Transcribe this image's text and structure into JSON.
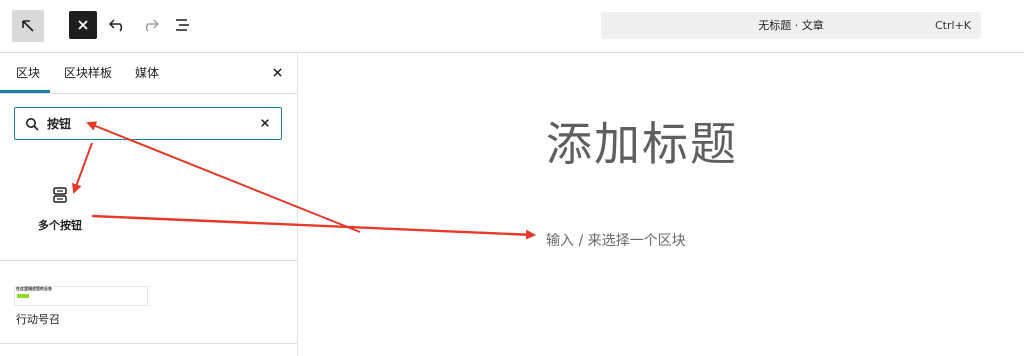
{
  "topbar": {
    "wp_icon": "arrow-up-left-icon",
    "close_icon": "close-icon",
    "undo_icon": "undo-icon",
    "redo_icon": "redo-icon",
    "list_icon": "list-view-icon",
    "command_title": "无标题 · 文章",
    "command_shortcut": "Ctrl+K"
  },
  "inserter": {
    "tabs": [
      "区块",
      "区块样板",
      "媒体"
    ],
    "active_tab": "区块",
    "search": {
      "value": "按钮",
      "placeholder": ""
    },
    "results": [
      {
        "label": "多个按钮",
        "icon": "buttons-icon"
      }
    ],
    "patterns": [
      {
        "label": "行动号召",
        "preview_heading": "在这里描述您的业务"
      }
    ]
  },
  "editor": {
    "title_placeholder": "添加标题",
    "block_prompt": "输入 / 来选择一个区块"
  },
  "colors": {
    "accent": "#1e7fa6",
    "annotation_arrow": "#e53a2a",
    "pattern_button": "#8edb2b"
  }
}
